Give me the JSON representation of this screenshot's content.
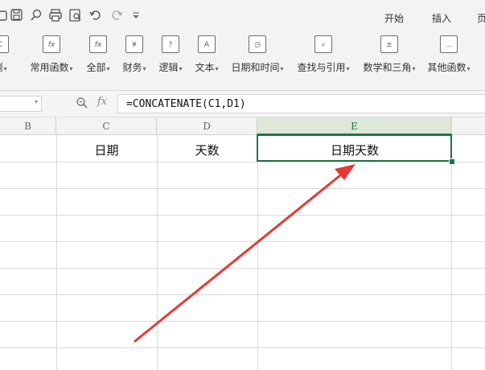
{
  "ribbon": {
    "tabs": [
      "开始",
      "插入",
      "页"
    ],
    "groups": [
      {
        "label": "浏",
        "icon": "recent-functions-icon"
      },
      {
        "label": "常用函数",
        "icon": "fx-common-icon"
      },
      {
        "label": "全部",
        "icon": "fx-all-icon"
      },
      {
        "label": "财务",
        "icon": "finance-icon"
      },
      {
        "label": "逻辑",
        "icon": "logic-icon"
      },
      {
        "label": "文本",
        "icon": "text-icon"
      },
      {
        "label": "日期和时间",
        "icon": "clock-icon"
      },
      {
        "label": "查找与引用",
        "icon": "lookup-icon"
      },
      {
        "label": "数学和三角",
        "icon": "math-icon"
      },
      {
        "label": "其他函数",
        "icon": "more-functions-icon"
      }
    ]
  },
  "formula_bar": {
    "fx_label": "fx",
    "formula": "=CONCATENATE(C1,D1)"
  },
  "columns": [
    "B",
    "C",
    "D",
    "E"
  ],
  "cells": {
    "C1": "日期",
    "D1": "天数",
    "E1": "日期天数"
  },
  "colors": {
    "selection": "#217346",
    "arrow": "#e53935"
  }
}
